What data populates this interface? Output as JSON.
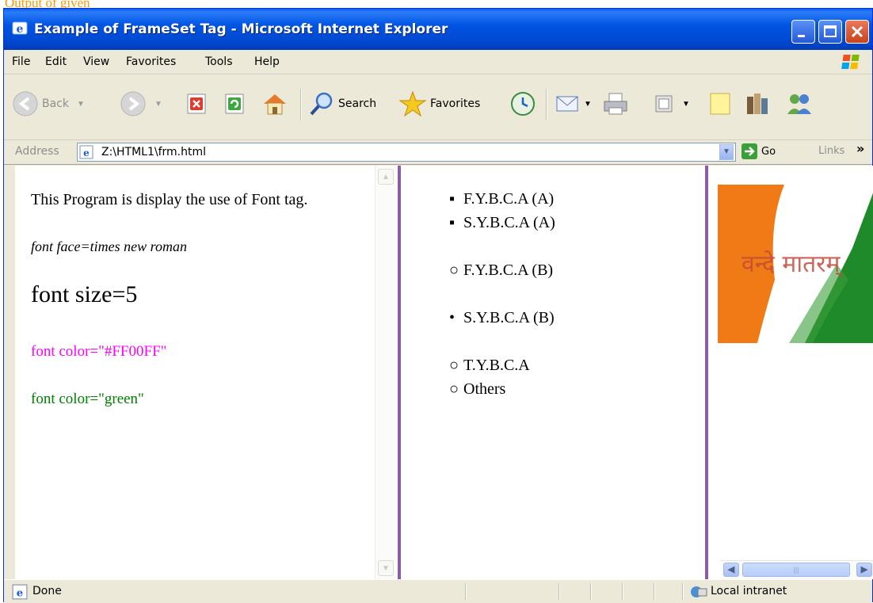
{
  "top_caption": "Output of given",
  "window": {
    "title": "Example of FrameSet Tag - Microsoft Internet Explorer"
  },
  "menu": [
    "File",
    "Edit",
    "View",
    "Favorites",
    "Tools",
    "Help"
  ],
  "toolbar": {
    "back_label": "Back",
    "search_label": "Search",
    "favorites_label": "Favorites"
  },
  "address": {
    "label": "Address",
    "url": "Z:\\HTML1\\frm.html",
    "go_label": "Go",
    "links_label": "Links",
    "links_chevron": "»"
  },
  "left_frame": {
    "line1": "This Program is display the use of Font tag.",
    "line2": "font face=times new roman",
    "line3": "font size=5",
    "line4": "font color=\"#FF00FF\"",
    "line5": "font color=\"green\"",
    "magenta": "#FF00FF",
    "green": "#008000"
  },
  "middle_frame": {
    "items": [
      {
        "text": "F.Y.B.C.A (A)",
        "bullet": "square"
      },
      {
        "text": "S.Y.B.C.A (A)",
        "bullet": "square"
      },
      {
        "text": "F.Y.B.C.A (B)",
        "bullet": "circle"
      },
      {
        "text": "S.Y.B.C.A (B)",
        "bullet": "disc"
      },
      {
        "text": "T.Y.B.C.A",
        "bullet": "circle"
      },
      {
        "text": "Others",
        "bullet": "circle"
      }
    ]
  },
  "right_frame": {
    "banner_text": "वन्दे मातरम्"
  },
  "status": {
    "text": "Done",
    "zone": "Local intranet"
  }
}
